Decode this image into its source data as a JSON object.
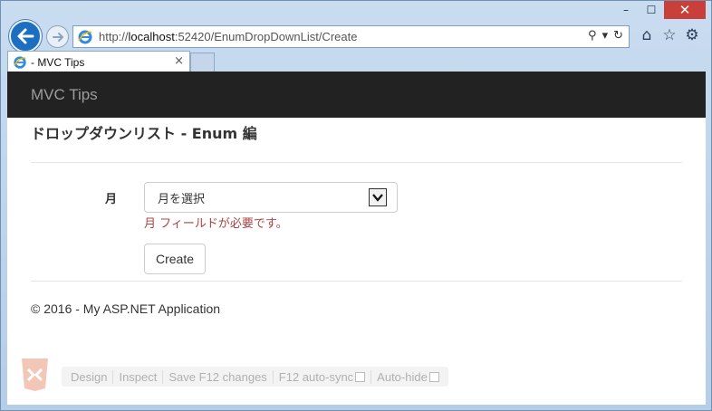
{
  "browser": {
    "url_prefix": "http://",
    "url_host": "localhost",
    "url_rest": ":52420/EnumDropDownList/Create",
    "tab_title": "- MVC Tips",
    "tab_close": "×",
    "win_minimize": "–",
    "win_maximize": "☐",
    "win_close": "✕",
    "search_glyph": "⚲",
    "dropdown_glyph": "▾",
    "refresh_glyph": "↻",
    "home_glyph": "⌂",
    "favorites_glyph": "☆",
    "settings_glyph": "⚙"
  },
  "page": {
    "brand": "MVC Tips",
    "title": "ドロップダウンリスト - Enum 編",
    "form": {
      "month_label": "月",
      "month_select_value": "月を選択",
      "validation_message": "月 フィールドが必要です。",
      "create_button": "Create"
    },
    "footer": "© 2016 - My ASP.NET Application"
  },
  "browser_link": {
    "items": [
      "Design",
      "Inspect",
      "Save F12 changes",
      "F12 auto-sync",
      "Auto-hide"
    ]
  },
  "colors": {
    "navbar_bg": "#222222",
    "brand_text": "#9d9d9d",
    "validation": "#a94442",
    "ie_blue": "#1c6fc0",
    "close_red": "#c9403a"
  }
}
